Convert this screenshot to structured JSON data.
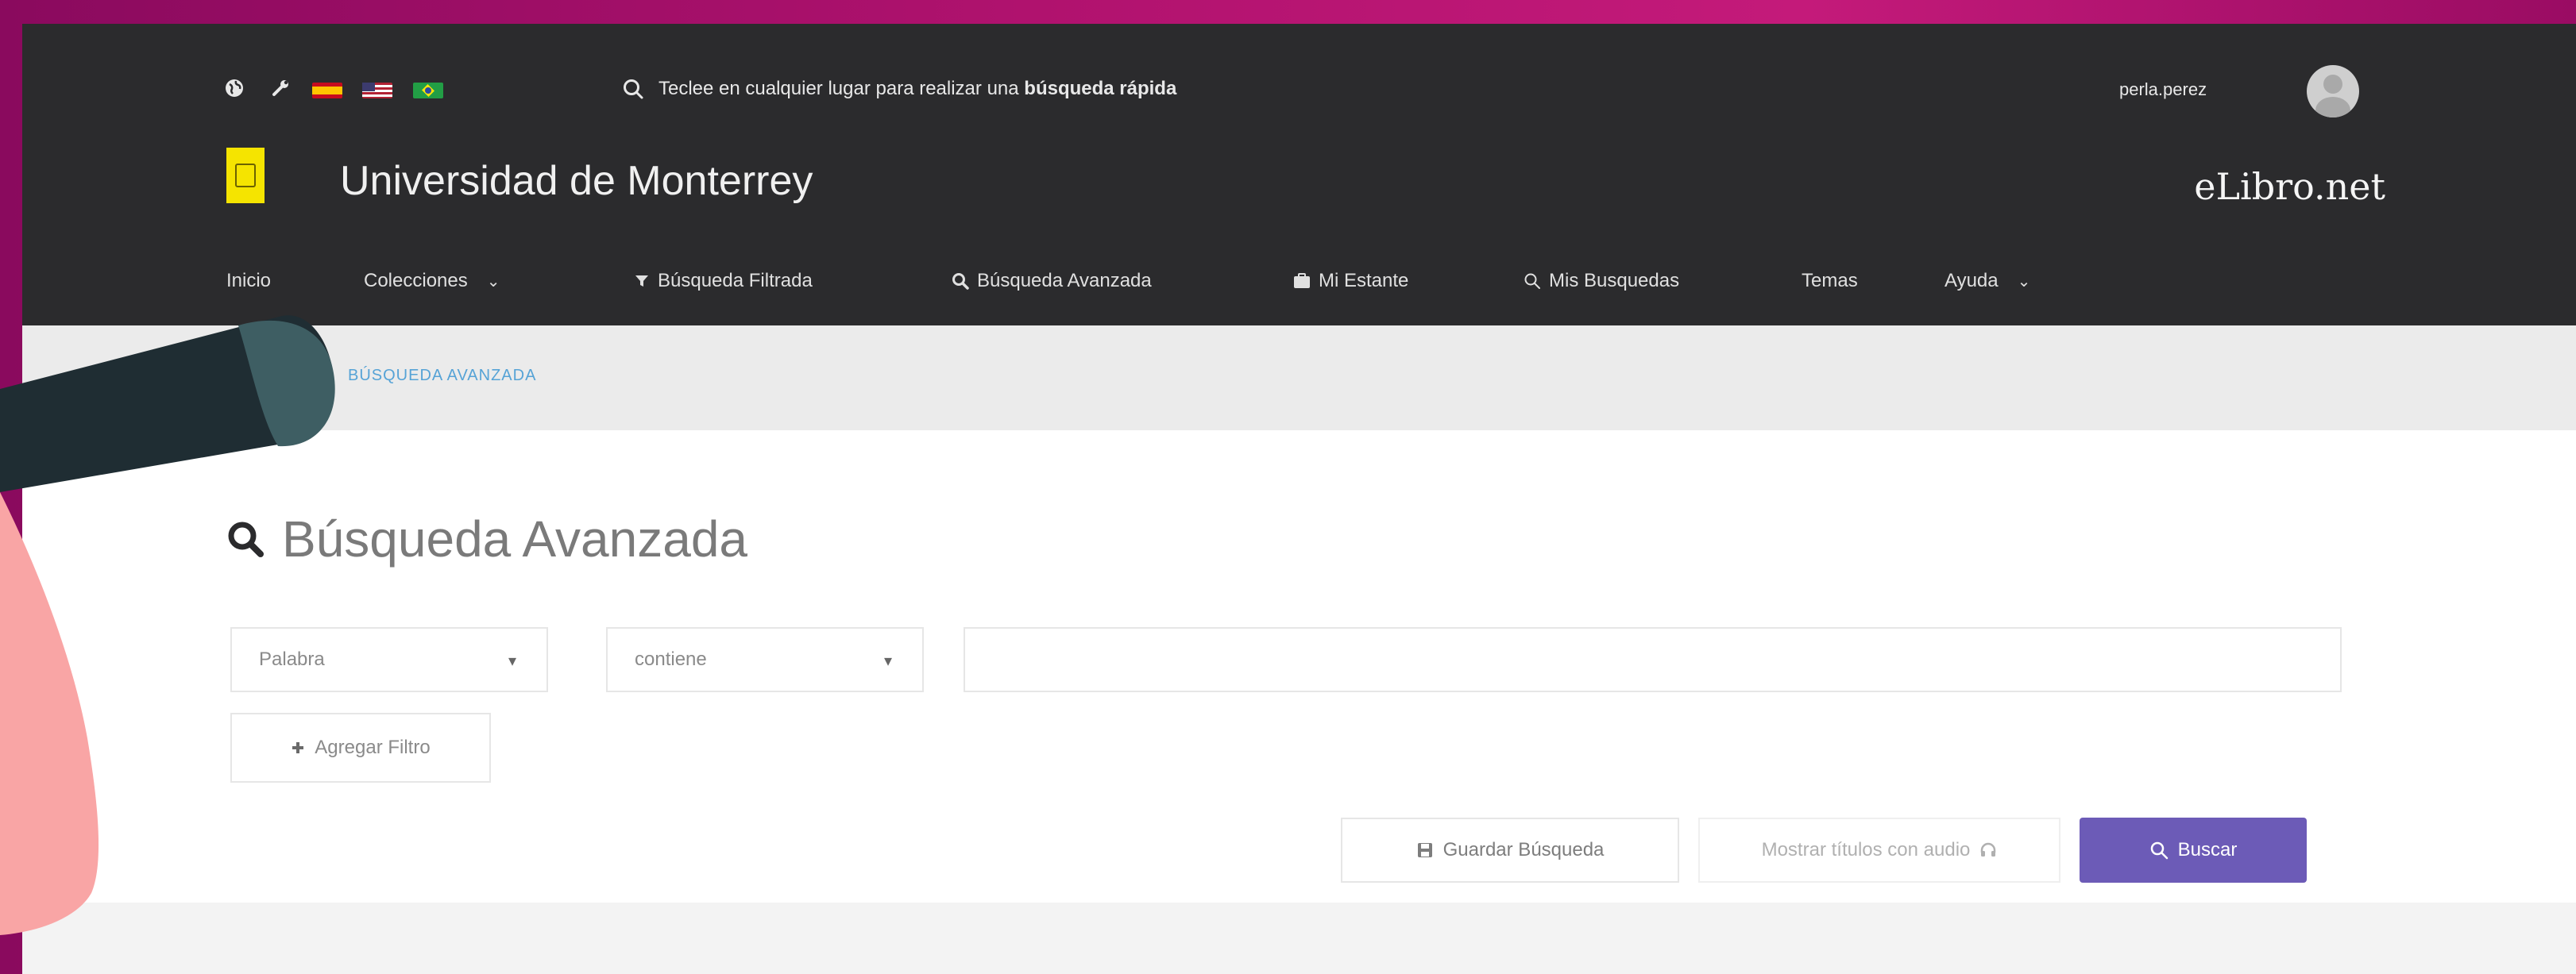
{
  "topbar": {
    "quick_search_prefix": "Teclee en cualquier lugar para realizar una ",
    "quick_search_bold": "búsqueda rápida",
    "user_name": "perla.perez"
  },
  "brand": {
    "university_name": "Universidad de Monterrey",
    "site_name": "eLibro.net"
  },
  "nav": {
    "items": [
      {
        "label": "Inicio",
        "icon": ""
      },
      {
        "label": "Colecciones",
        "icon": "chevron-down-icon"
      },
      {
        "label": "Búsqueda Filtrada",
        "icon": "filter-icon"
      },
      {
        "label": "Búsqueda Avanzada",
        "icon": "search-plus-icon"
      },
      {
        "label": "Mi Estante",
        "icon": "shelf-icon"
      },
      {
        "label": "Mis Busquedas",
        "icon": "search-icon"
      },
      {
        "label": "Temas",
        "icon": ""
      },
      {
        "label": "Ayuda",
        "icon": "chevron-down-icon"
      }
    ]
  },
  "breadcrumb": {
    "current": "BÚSQUEDA AVANZADA"
  },
  "page": {
    "title": "Búsqueda Avanzada"
  },
  "filters": {
    "field_selected": "Palabra",
    "operator_selected": "contiene",
    "search_value": "",
    "add_filter_label": "Agregar Filtro"
  },
  "actions": {
    "save_label": "Guardar Búsqueda",
    "audio_label": "Mostrar títulos con audio",
    "search_label": "Buscar"
  },
  "colors": {
    "topbar_bg": "#2b2b2d",
    "accent_button": "#6c5bb7",
    "breadcrumb_link": "#56a3d6",
    "logo_yellow": "#f5e400"
  }
}
